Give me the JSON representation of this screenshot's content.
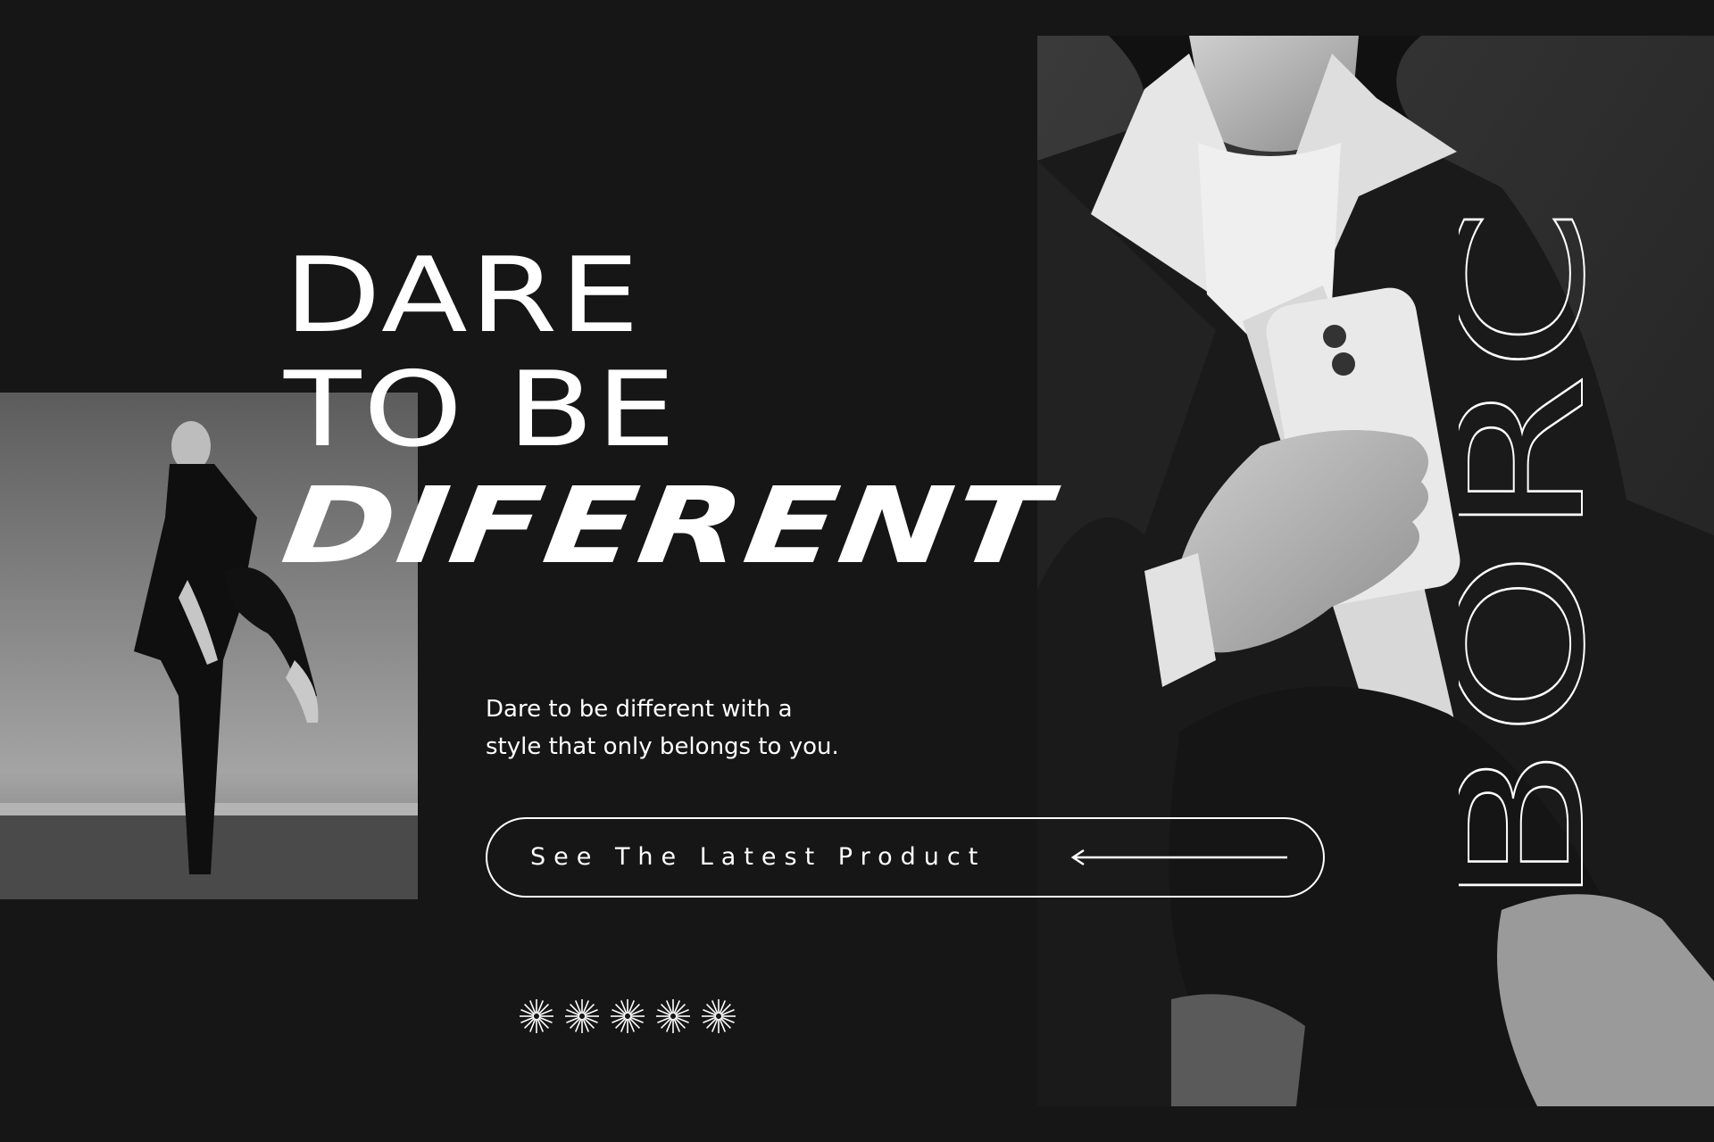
{
  "headline": {
    "line1": "DARE",
    "line2": "TO BE",
    "line3": "DIFERENT"
  },
  "tagline": {
    "line1": "Dare to be different with a",
    "line2": "style that only belongs to you."
  },
  "cta": {
    "label": "See The Latest Product"
  },
  "brand": {
    "name": "BORC"
  },
  "decor": {
    "star_count": 5
  },
  "colors": {
    "background": "#161616",
    "text": "#ffffff"
  }
}
